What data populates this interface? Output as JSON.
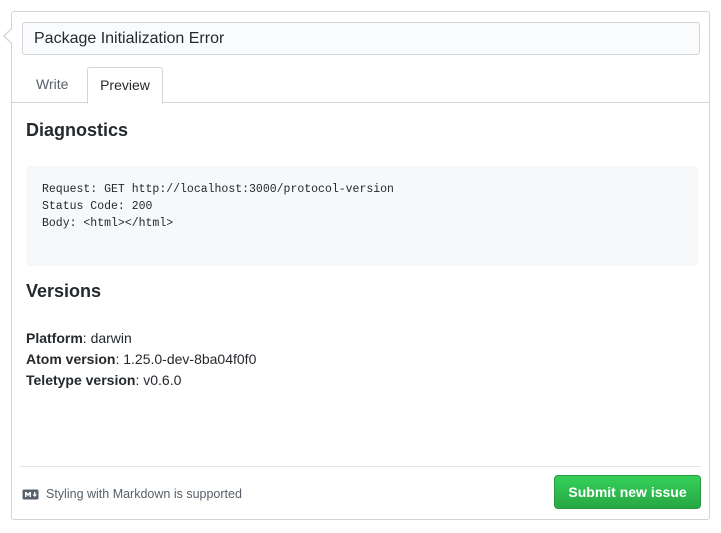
{
  "issue": {
    "title_value": "Package Initialization Error"
  },
  "tabs": [
    {
      "label": "Write"
    },
    {
      "label": "Preview"
    }
  ],
  "preview": {
    "diagnostics_heading": "Diagnostics",
    "code_lines": [
      "Request: GET http://localhost:3000/protocol-version",
      "Status Code: 200",
      "Body: <html></html>"
    ],
    "versions_heading": "Versions",
    "versions": [
      {
        "label": "Platform",
        "value": ": darwin"
      },
      {
        "label": "Atom version",
        "value": ": 1.25.0-dev-8ba04f0f0"
      },
      {
        "label": "Teletype version",
        "value": ": v0.6.0"
      }
    ]
  },
  "footer": {
    "markdown_note": "Styling with Markdown is supported",
    "submit_label": "Submit new issue"
  },
  "icons": {
    "markdown": "markdown-icon"
  },
  "colors": {
    "submit_green": "#28a745"
  }
}
